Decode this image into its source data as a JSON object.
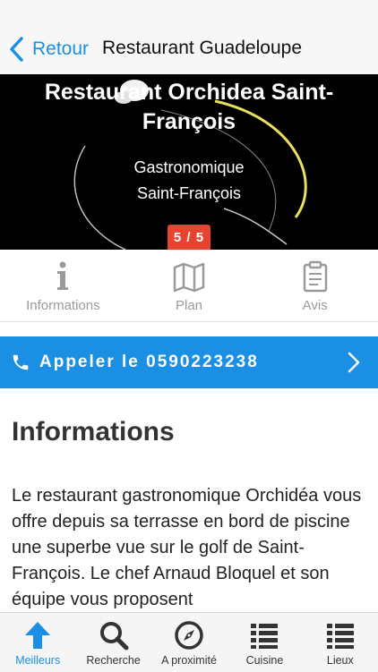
{
  "nav": {
    "back_label": "Retour",
    "title": "Restaurant Guadeloupe"
  },
  "hero": {
    "title": "Restaurant Orchidea Saint-François",
    "subtitle_line1": "Gastronomique",
    "subtitle_line2": "Saint-François",
    "badge": "5 / 5"
  },
  "tabs": [
    {
      "label": "Informations",
      "icon": "info-icon"
    },
    {
      "label": "Plan",
      "icon": "map-icon"
    },
    {
      "label": "Avis",
      "icon": "clipboard-icon"
    }
  ],
  "call": {
    "label": "Appeler le 0590223238",
    "icon": "phone-icon"
  },
  "content": {
    "title": "Informations",
    "body": "Le restaurant gastronomique Orchidéa vous offre depuis sa terrasse en bord de piscine une superbe vue sur le golf de Saint-François. Le chef Arnaud Bloquel et son équipe vous proposent"
  },
  "tabbar": [
    {
      "label": "Meilleurs",
      "icon": "arrow-up-icon",
      "active": true
    },
    {
      "label": "Recherche",
      "icon": "search-icon",
      "active": false
    },
    {
      "label": "A proximité",
      "icon": "compass-icon",
      "active": false
    },
    {
      "label": "Cuisine",
      "icon": "list-icon",
      "active": false
    },
    {
      "label": "Lieux",
      "icon": "list-icon",
      "active": false
    }
  ],
  "colors": {
    "accent": "#1a8fe3",
    "badge": "#e8432e"
  }
}
